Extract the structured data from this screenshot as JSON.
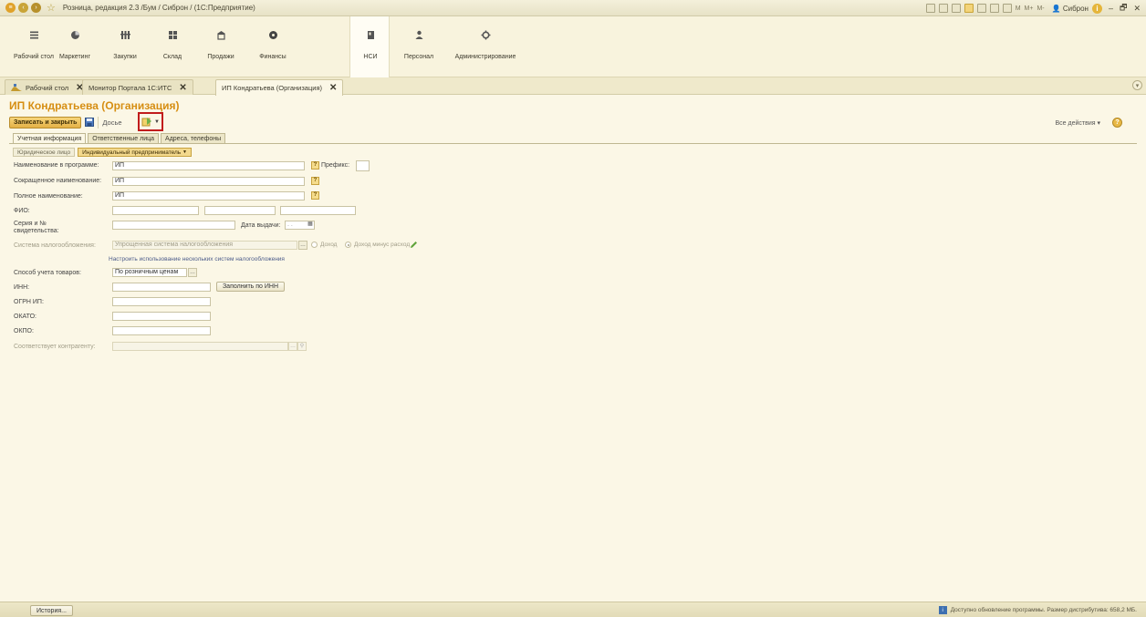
{
  "window": {
    "title": "Розница, редакция 2.3 /Бум / Сиброн / (1С:Предприятие)",
    "user": "Сиброн",
    "minimize": "–",
    "restore": "🗗",
    "close": "✕"
  },
  "sections": [
    {
      "label": "Рабочий стол",
      "icon": "menu-icon"
    },
    {
      "label": "Маркетинг",
      "icon": "pie-chart-icon"
    },
    {
      "label": "Закупки",
      "icon": "cart-icon"
    },
    {
      "label": "Склад",
      "icon": "warehouse-icon"
    },
    {
      "label": "Продажи",
      "icon": "shop-icon"
    },
    {
      "label": "Финансы",
      "icon": "coin-icon"
    },
    {
      "label": "НСИ",
      "icon": "book-icon"
    },
    {
      "label": "Персонал",
      "icon": "person-icon"
    },
    {
      "label": "Администрирование",
      "icon": "gear-icon"
    }
  ],
  "window_tabs": [
    {
      "label": "Рабочий стол",
      "close": "✕"
    },
    {
      "label": "Монитор Портала 1С:ИТС",
      "close": "✕"
    },
    {
      "label": "ИП Кондратьева (Организация)",
      "close": "✕"
    }
  ],
  "form": {
    "title": "ИП Кондратьева (Организация)",
    "save_close": "Записать и закрыть",
    "dossier": "Досье",
    "all_actions": "Все действия ▾",
    "help": "?",
    "tabs": [
      "Учетная информация",
      "Ответственные лица",
      "Адреса, телефоны"
    ],
    "switch": {
      "legal": "Юридическое лицо",
      "individual": "Индивидуальный предприниматель"
    }
  },
  "fields": {
    "name_program": {
      "label": "Наименование в программе:",
      "value": "ИП"
    },
    "prefix": {
      "label": "Префикс:",
      "value": ""
    },
    "short_name": {
      "label": "Сокращенное наименование:",
      "value": "ИП"
    },
    "full_name": {
      "label": "Полное наименование:",
      "value": "ИП"
    },
    "fio": {
      "label": "ФИО:"
    },
    "certificate": {
      "label_line1": "Серия и №",
      "label_line2": "свидетельства:",
      "value": ""
    },
    "issue_date": {
      "label": "Дата выдачи:",
      "value": ". ."
    },
    "tax_system": {
      "label": "Система налогообложения:",
      "value": "Упрощенная система налогообложения",
      "opt_income": "Доход",
      "opt_income_minus": "Доход минус расход"
    },
    "tax_link": "Настроить использование нескольких систем налогообложения",
    "goods_accounting": {
      "label": "Способ учета товаров:",
      "value": "По розничным ценам"
    },
    "inn": {
      "label": "ИНН:",
      "value": "",
      "fill_btn": "Заполнить по ИНН"
    },
    "ogrn": {
      "label": "ОГРН ИП:",
      "value": ""
    },
    "okato": {
      "label": "ОКАТО:",
      "value": ""
    },
    "okpo": {
      "label": "ОКПО:",
      "value": ""
    },
    "counterparty": {
      "label": "Соответствует контрагенту:",
      "value": ""
    }
  },
  "status": {
    "history": "История...",
    "message": "Доступно обновление программы. Размер дистрибутива: 658,2 МБ."
  },
  "colors": {
    "accent": "#d68e12",
    "highlight": "#c11c1c"
  }
}
